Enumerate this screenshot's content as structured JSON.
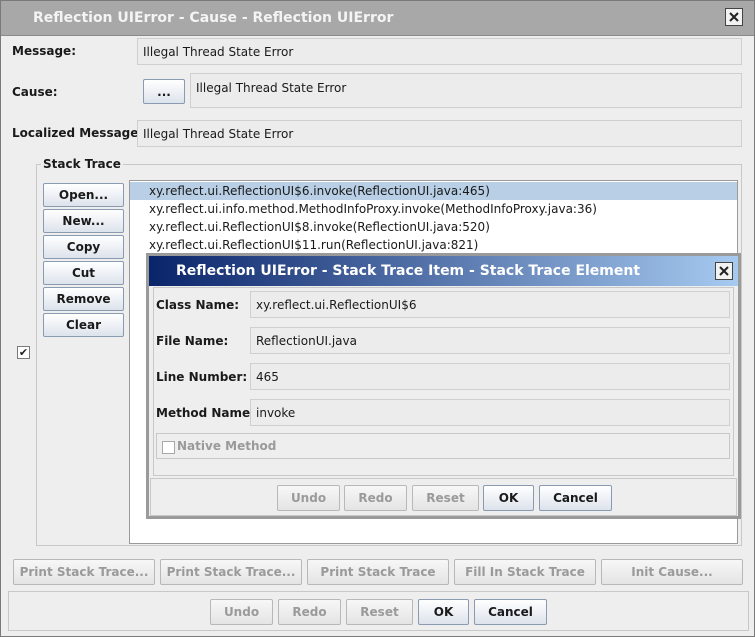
{
  "window": {
    "title": "Reflection UIError - Cause - Reflection UIError",
    "close_icon": "close-icon"
  },
  "fields": {
    "message_label": "Message:",
    "message_value": "Illegal Thread State Error",
    "cause_label": "Cause:",
    "cause_button": "...",
    "cause_value": "Illegal Thread State Error",
    "localized_label": "Localized Message:",
    "localized_value": "Illegal Thread State Error"
  },
  "stack_trace": {
    "title": "Stack Trace",
    "buttons": [
      "Open...",
      "New...",
      "Copy",
      "Cut",
      "Remove",
      "Clear"
    ],
    "items": [
      "xy.reflect.ui.ReflectionUI$6.invoke(ReflectionUI.java:465)",
      "xy.reflect.ui.info.method.MethodInfoProxy.invoke(MethodInfoProxy.java:36)",
      "xy.reflect.ui.ReflectionUI$8.invoke(ReflectionUI.java:520)",
      "xy.reflect.ui.ReflectionUI$11.run(ReflectionUI.java:821)"
    ],
    "selected_index": 0
  },
  "left_checkbox": {
    "checked": true,
    "mark": "✔"
  },
  "dialog": {
    "title": "Reflection UIError - Stack Trace Item - Stack Trace Element",
    "class_name_label": "Class Name:",
    "class_name_value": "xy.reflect.ui.ReflectionUI$6",
    "file_name_label": "File Name:",
    "file_name_value": "ReflectionUI.java",
    "line_number_label": "Line Number:",
    "line_number_value": "465",
    "method_name_label": "Method Name:",
    "method_name_value": "invoke",
    "native_method_label": "Native Method",
    "native_method_checked": false,
    "buttons": {
      "undo": "Undo",
      "redo": "Redo",
      "reset": "Reset",
      "ok": "OK",
      "cancel": "Cancel"
    }
  },
  "actions": [
    "Print Stack Trace...",
    "Print Stack Trace...",
    "Print Stack Trace",
    "Fill In Stack Trace",
    "Init Cause..."
  ],
  "bottom_buttons": {
    "undo": "Undo",
    "redo": "Redo",
    "reset": "Reset",
    "ok": "OK",
    "cancel": "Cancel"
  },
  "colors": {
    "dialog_title_start": "#0a246a",
    "dialog_title_end": "#a6caf0",
    "selection": "#b8cfe5",
    "title_inactive": "#a8a8a8"
  }
}
